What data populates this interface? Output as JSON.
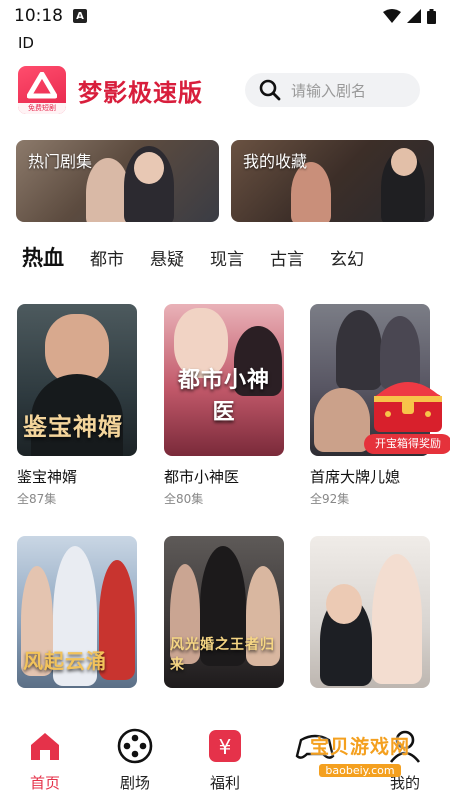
{
  "status_bar": {
    "time": "10:18",
    "notification_badge": "A"
  },
  "id_label": "ID",
  "header": {
    "app_name": "梦影极速版",
    "logo_caption": "免费短剧",
    "search": {
      "placeholder": "请输入剧名"
    }
  },
  "banners": [
    {
      "title": "热门剧集"
    },
    {
      "title": "我的收藏"
    }
  ],
  "categories": [
    "热血",
    "都市",
    "悬疑",
    "现言",
    "古言",
    "玄幻"
  ],
  "dramas": [
    {
      "title": "鉴宝神婿",
      "episodes": "全87集",
      "poster_text": "鉴宝神婿",
      "color": "#2e3a3f"
    },
    {
      "title": "都市小神医",
      "episodes": "全80集",
      "poster_text": "都市小神医",
      "color": "#b9405a"
    },
    {
      "title": "首席大牌儿媳",
      "episodes": "全92集",
      "poster_text": "",
      "color": "#585663"
    },
    {
      "title": "",
      "episodes": "",
      "poster_text": "风起云涌",
      "color": "#8ea6c0"
    },
    {
      "title": "",
      "episodes": "",
      "poster_text": "风光婚之王者归来",
      "color": "#3e3a3a"
    },
    {
      "title": "",
      "episodes": "",
      "poster_text": "",
      "color": "#d8d4d0"
    }
  ],
  "treasure": {
    "label": "开宝箱得奖励"
  },
  "nav": [
    {
      "label": "首页",
      "icon": "home-icon",
      "active": true
    },
    {
      "label": "剧场",
      "icon": "film-reel-icon",
      "active": false
    },
    {
      "label": "福利",
      "icon": "yen-coupon-icon",
      "active": false
    },
    {
      "label": "",
      "icon": "gamepad-icon",
      "active": false
    },
    {
      "label": "我的",
      "icon": "user-icon",
      "active": false
    }
  ],
  "watermark": {
    "title": "宝贝游戏网",
    "url": "baobeiy.com"
  },
  "colors": {
    "accent": "#e5324a",
    "brand": "#d81e3c"
  }
}
